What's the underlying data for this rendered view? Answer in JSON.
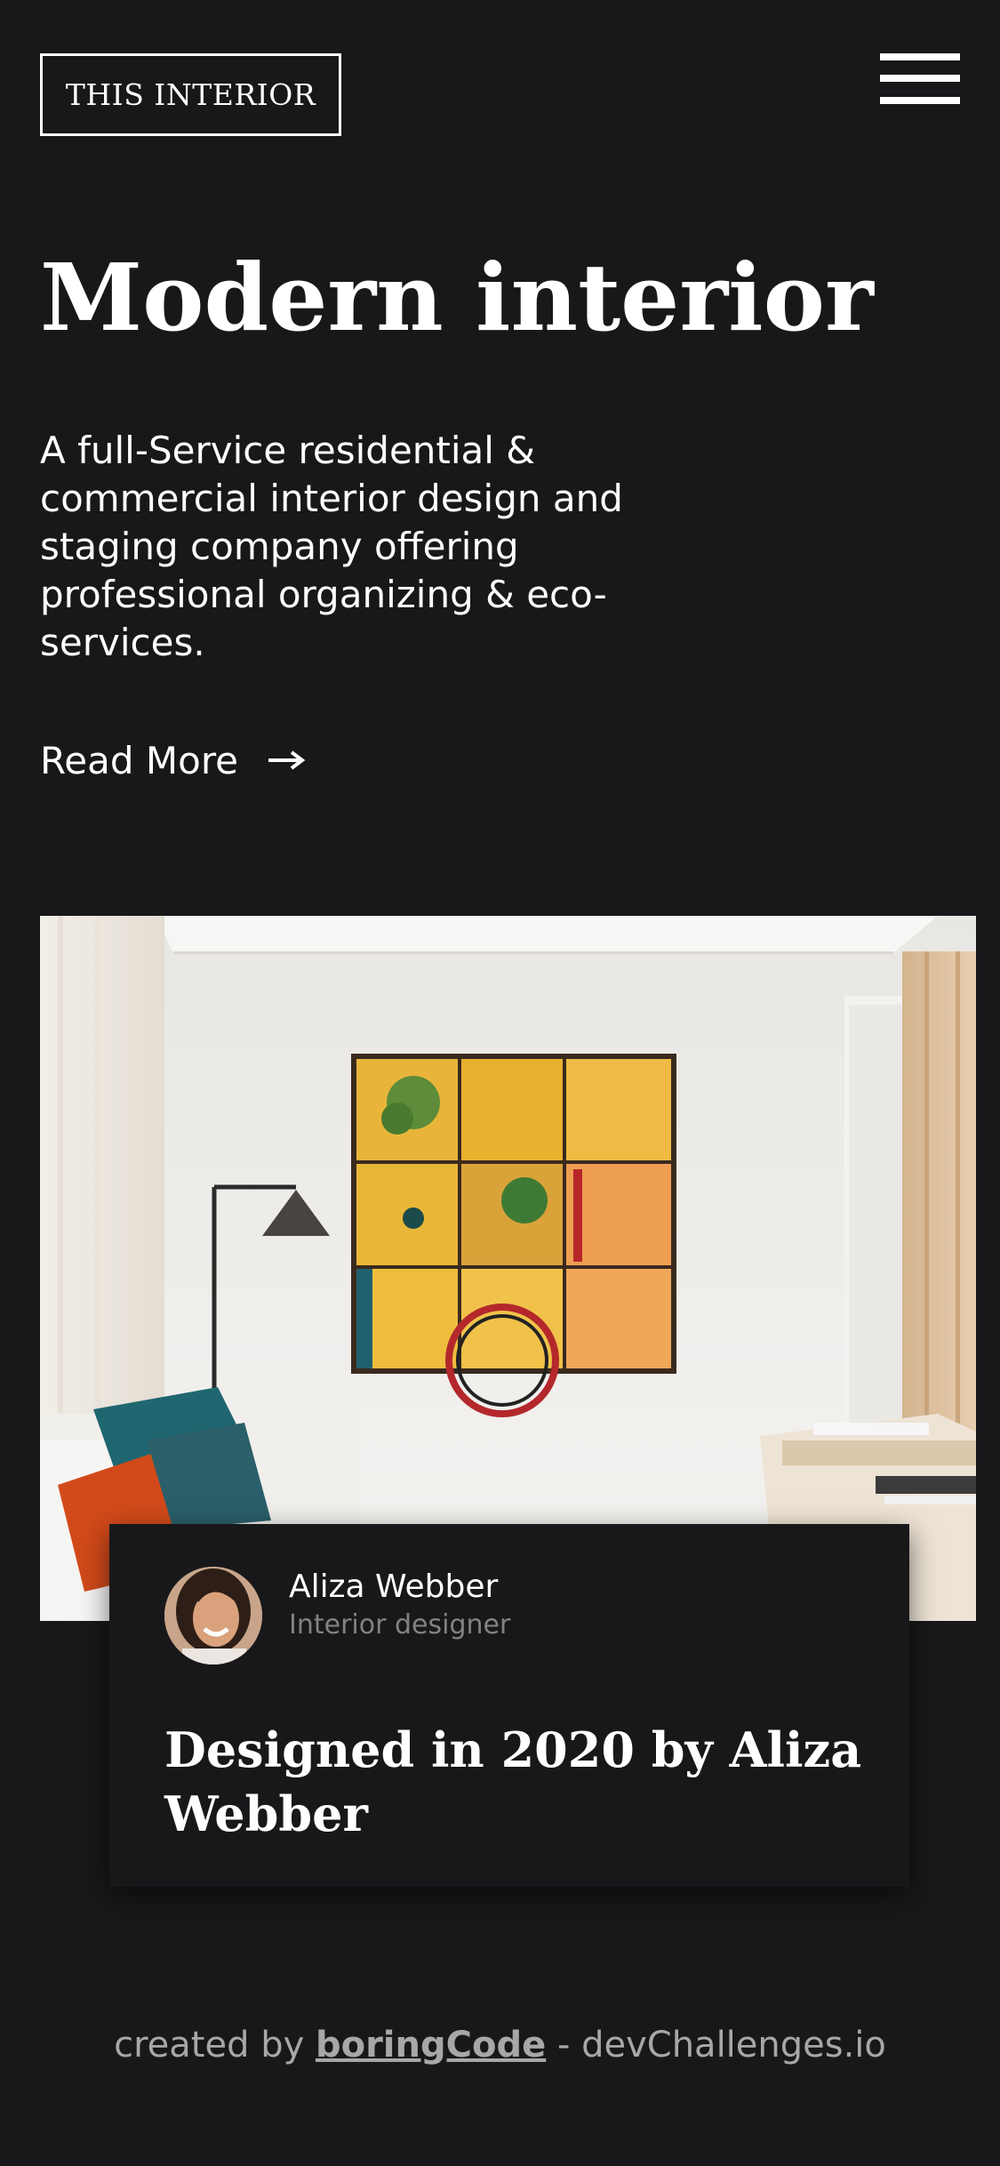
{
  "header": {
    "brand_label": "THIS INTERIOR",
    "menu_icon": "hamburger-menu-icon"
  },
  "hero": {
    "title": "Modern interior",
    "description": "A full-Service residential & commercial interior design and staging company offering professional organizing & eco-services.",
    "read_more_label": "Read More",
    "read_more_icon": "arrow-right-icon"
  },
  "photo": {
    "subject": "living room with yellow window-panel artwork, floor lamp, sofa with orange and teal pillows"
  },
  "card": {
    "author_name": "Aliza Webber",
    "author_role": "Interior designer",
    "title": "Designed in 2020 by Aliza Webber"
  },
  "footer": {
    "prefix": "created by ",
    "link_label": "boringCode",
    "suffix": " - devChallenges.io"
  },
  "colors": {
    "background": "#18181b",
    "text": "#ffffff",
    "muted": "#828282",
    "footer_text": "#a7a7a7"
  }
}
